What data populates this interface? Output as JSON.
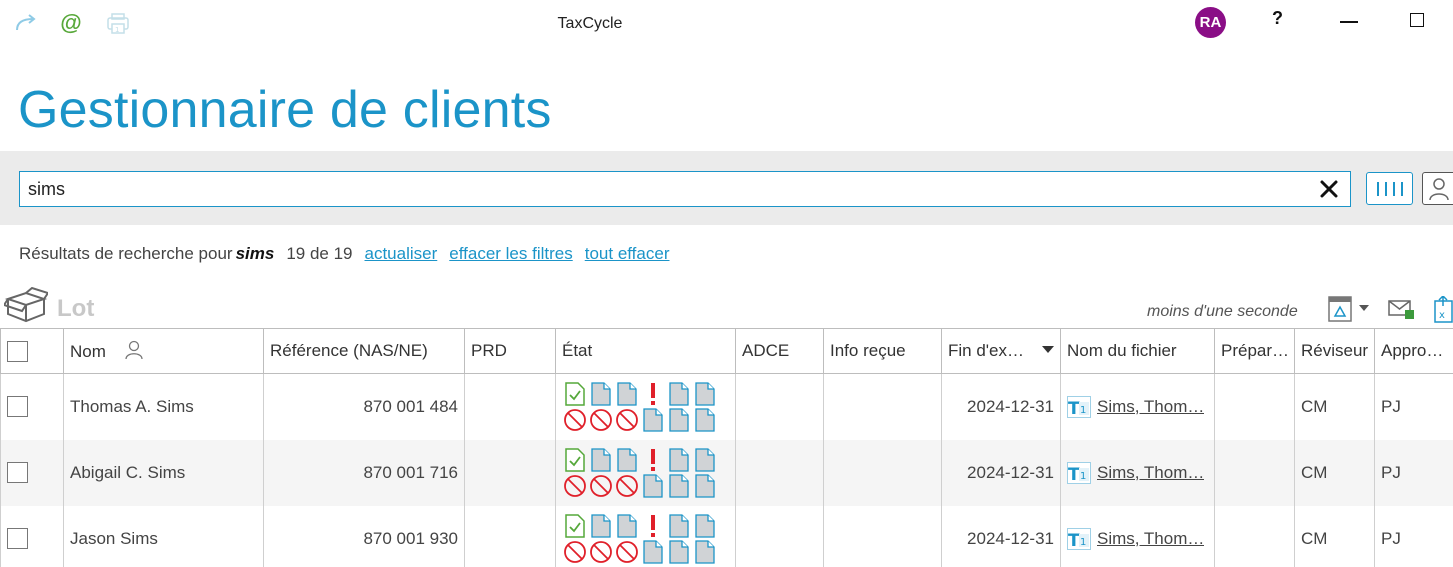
{
  "window": {
    "title": "TaxCycle",
    "avatar_initials": "RA",
    "help_label": "?"
  },
  "page": {
    "title": "Gestionnaire de clients"
  },
  "search": {
    "value": "sims"
  },
  "results": {
    "prefix": "Résultats de recherche pour",
    "term": "sims",
    "count": "19 de 19",
    "links": {
      "refresh": "actualiser",
      "clear_filters": "effacer les filtres",
      "clear_all": "tout effacer"
    }
  },
  "batch": {
    "label": "Lot",
    "elapsed": "moins d'une seconde"
  },
  "columns": {
    "name": "Nom",
    "reference": "Référence (NAS/NE)",
    "prd": "PRD",
    "status": "État",
    "adce": "ADCE",
    "info": "Info reçue",
    "year_end": "Fin d'ex…",
    "filename": "Nom du fichier",
    "preparer": "Prépar…",
    "reviewer": "Réviseur",
    "approver": "Appro…"
  },
  "rows": [
    {
      "name": "Thomas A. Sims",
      "reference": "870 001 484",
      "year_end": "2024-12-31",
      "filename": "Sims, Thom…",
      "reviewer": "CM",
      "approver": "PJ"
    },
    {
      "name": "Abigail C. Sims",
      "reference": "870 001 716",
      "year_end": "2024-12-31",
      "filename": "Sims, Thom…",
      "reviewer": "CM",
      "approver": "PJ"
    },
    {
      "name": "Jason Sims",
      "reference": "870 001 930",
      "year_end": "2024-12-31",
      "filename": "Sims, Thom…",
      "reviewer": "CM",
      "approver": "PJ"
    }
  ],
  "icons": {
    "status_top": [
      "check-doc-icon",
      "doc-icon",
      "doc-icon",
      "exclamation-icon",
      "doc-icon",
      "doc-icon"
    ],
    "status_bottom": [
      "no-entry-icon",
      "no-entry-icon",
      "no-entry-icon",
      "doc-icon",
      "doc-icon",
      "doc-icon"
    ],
    "file_type": "t1-icon"
  },
  "colors": {
    "accent": "#1b94c8",
    "avatar": "#8a0e86",
    "warning": "#e0202a",
    "ok": "#55a83a"
  }
}
